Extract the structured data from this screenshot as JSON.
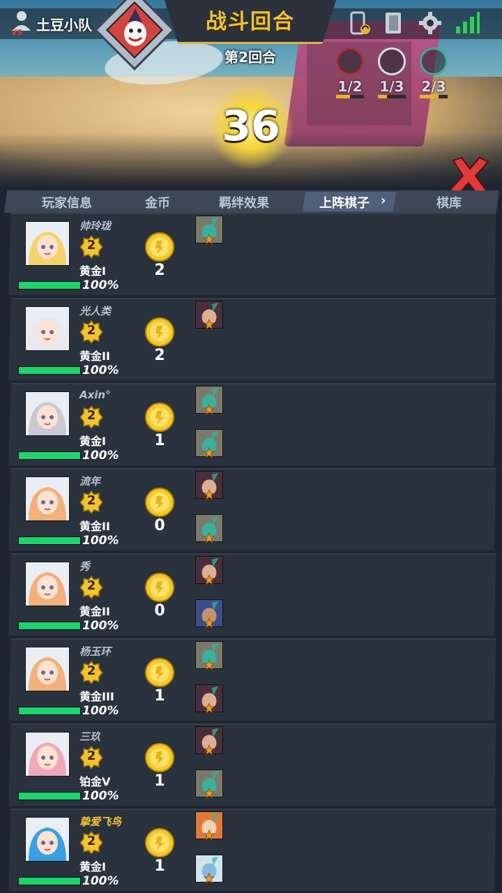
{
  "header": {
    "team_name": "土豆小队",
    "round_title": "战斗回合",
    "round_number": "第2回合",
    "timer": "36"
  },
  "stats": [
    {
      "icon": "round-stat-icon",
      "text": "1/2",
      "fill": 0.5
    },
    {
      "icon": "moon-stat-icon",
      "text": "1/3",
      "fill": 0.33
    },
    {
      "icon": "shield-stat-icon",
      "text": "2/3",
      "fill": 0.67
    }
  ],
  "tabs": {
    "info": "玩家信息",
    "gold": "金币",
    "bond": "羁绊效果",
    "board": "上阵棋子",
    "board_arrow": "›",
    "bench": "棋库"
  },
  "players": [
    {
      "name": "帅玲珑",
      "level": "2",
      "rank": "黄金I",
      "hp": "100%",
      "hp_fill": 1.0,
      "gold": "2",
      "avatar_color": "#f3d26b",
      "pieces": [
        {
          "color": "#7a7a6a",
          "accent": "#31b8a7"
        }
      ],
      "highlight": false
    },
    {
      "name": "光人类",
      "level": "2",
      "rank": "黄金II",
      "hp": "100%",
      "hp_fill": 1.0,
      "gold": "2",
      "avatar_color": "#e8e8ee",
      "pieces": [
        {
          "color": "#4a2f3a",
          "accent": "#f5c5a5"
        }
      ],
      "highlight": false
    },
    {
      "name": "Axin°",
      "level": "2",
      "rank": "黄金I",
      "hp": "100%",
      "hp_fill": 1.0,
      "gold": "1",
      "avatar_color": "#c9c9d3",
      "pieces": [
        {
          "color": "#7a7a6a",
          "accent": "#31b8a7"
        },
        {
          "color": "#7a7a6a",
          "accent": "#31b8a7"
        }
      ],
      "highlight": false
    },
    {
      "name": "流年",
      "level": "2",
      "rank": "黄金II",
      "hp": "100%",
      "hp_fill": 1.0,
      "gold": "0",
      "avatar_color": "#f2b07a",
      "pieces": [
        {
          "color": "#4a2f3a",
          "accent": "#f5c5a5"
        },
        {
          "color": "#7a7a6a",
          "accent": "#31b8a7"
        }
      ],
      "highlight": false
    },
    {
      "name": "秀",
      "level": "2",
      "rank": "黄金II",
      "hp": "100%",
      "hp_fill": 1.0,
      "gold": "0",
      "avatar_color": "#f2b07a",
      "pieces": [
        {
          "color": "#4a2f3a",
          "accent": "#f5c5a5"
        },
        {
          "color": "#3a4f8a",
          "accent": "#d8a06a"
        }
      ],
      "highlight": false
    },
    {
      "name": "杨玉环",
      "level": "2",
      "rank": "黄金III",
      "hp": "100%",
      "hp_fill": 1.0,
      "gold": "1",
      "avatar_color": "#f2b07a",
      "pieces": [
        {
          "color": "#7a7a6a",
          "accent": "#31b8a7"
        },
        {
          "color": "#4a2f3a",
          "accent": "#f5c5a5"
        }
      ],
      "highlight": false
    },
    {
      "name": "三玖",
      "level": "2",
      "rank": "铂金V",
      "hp": "100%",
      "hp_fill": 1.0,
      "gold": "1",
      "avatar_color": "#f0a8b8",
      "pieces": [
        {
          "color": "#4a2f3a",
          "accent": "#f5c5a5"
        },
        {
          "color": "#7a7a6a",
          "accent": "#31b8a7"
        }
      ],
      "highlight": false
    },
    {
      "name": "挚爱飞鸟",
      "level": "2",
      "rank": "黄金I",
      "hp": "100%",
      "hp_fill": 1.0,
      "gold": "1",
      "avatar_color": "#3aa0e0",
      "pieces": [
        {
          "color": "#e07a3a",
          "accent": "#fbe0c8"
        },
        {
          "color": "#cfe6f0",
          "accent": "#7ab0d8"
        }
      ],
      "highlight": true
    }
  ],
  "colors": {
    "gold": "#f2c230",
    "hp_green": "#1fd46c",
    "row_bg": "#2a323e",
    "close_red": "#e03a3a"
  }
}
